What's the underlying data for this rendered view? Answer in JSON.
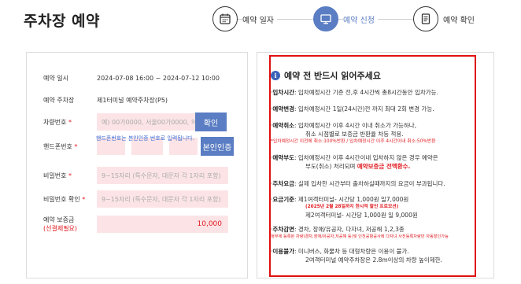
{
  "page": {
    "title": "주차장 예약"
  },
  "steps": [
    {
      "label": "예약 일자",
      "icon": "calendar-icon",
      "active": false
    },
    {
      "label": "예약 신청",
      "icon": "monitor-icon",
      "active": true
    },
    {
      "label": "예약 확인",
      "icon": "document-icon",
      "active": false
    }
  ],
  "colors": {
    "accent": "#5a7dc3",
    "input_bg": "#fce4e6",
    "red": "#e0191f",
    "link_blue": "#3b6bd6"
  },
  "form": {
    "period_label": "예약 일시",
    "period_value": "2024-07-08 16:00 ~ 2024-07-12 10:00",
    "lot_label": "예약 주차장",
    "lot_value": "제1터미널 예약주차장(P5)",
    "car_label": "차량번호",
    "car_placeholder": "예) 00가0000, 서울00가0000, 외",
    "confirm_button": "확인",
    "phone_label": "핸드폰번호",
    "verify_button": "본인인증",
    "verify_hint": "핸드폰번호는 본인인증 번호로 입력됩니다.",
    "password_label": "비밀번호",
    "password_placeholder": "9~15자리 (특수문자, 대문자 각 1자리 포함)",
    "password_confirm_label": "비밀번호 확인",
    "password_confirm_placeholder": "9~15자리 (특수문자, 대문자 각 1자리 포함)",
    "deposit_label": "예약 보증금",
    "deposit_sub": "(선결제필요)",
    "deposit_value": "10,000",
    "required_mark": "*"
  },
  "notice": {
    "title": "예약 전 반드시 읽어주세요",
    "items": [
      {
        "key": "입차시간",
        "text": ": 입차예정시간 기준 전,후 4시간씩 총8시간동안 입차가능."
      },
      {
        "key": "예약변경",
        "text": ": 입차예정시간 1일(24시간)전 까지 최대 2회 변경 가능."
      },
      {
        "key": "예약취소",
        "text": ": 입차예정시간 이후 4시간 이내 취소가 가능하나,",
        "line2": "취소 시점별로 보증금 반환율 차등 적용.",
        "red_line": "*입차예정시간 이전에 취소:100%반환 / 입차예정시간 이후 4시간이내 취소:50%반환"
      },
      {
        "key": "예약부도",
        "text": ": 입차예정시간 이후 4시간이내 입차하지 않은 경우 예약은",
        "line2_prefix": "부도(취소) 처리되며 ",
        "line2_red": "예약보증금 전액환수."
      },
      {
        "key": "주차요금",
        "text": ": 실제 입차한 시간부터 출차하실때까지의 요금이 부과됩니다."
      },
      {
        "key": "요금기준",
        "text": ": 제1여객터미널- 시간당 1,000원 일7,000원",
        "red_line": "(2025년 2월 28일까지 한시적 할인 프로모션)",
        "line3": "제2여객터미널- 시간당 1,000원 일 9,000원"
      },
      {
        "key": "주차감면",
        "text": ": 경차, 장애/유공자, 다자녀, 저공해 1,2,3종",
        "red_line": "정부에 등록된 차량(경차,장애/유공자,저공해 등)및 인천공항공사에 다자녀 사전등록차량만 자동할인가능"
      },
      {
        "key": "이용불가",
        "text": ": 미니버스, 화물차 등 대형차량은 이용이 불가.",
        "line2": "2여객터미널 예약주차장은 2.8m이상의 차량 높이제한."
      }
    ]
  }
}
